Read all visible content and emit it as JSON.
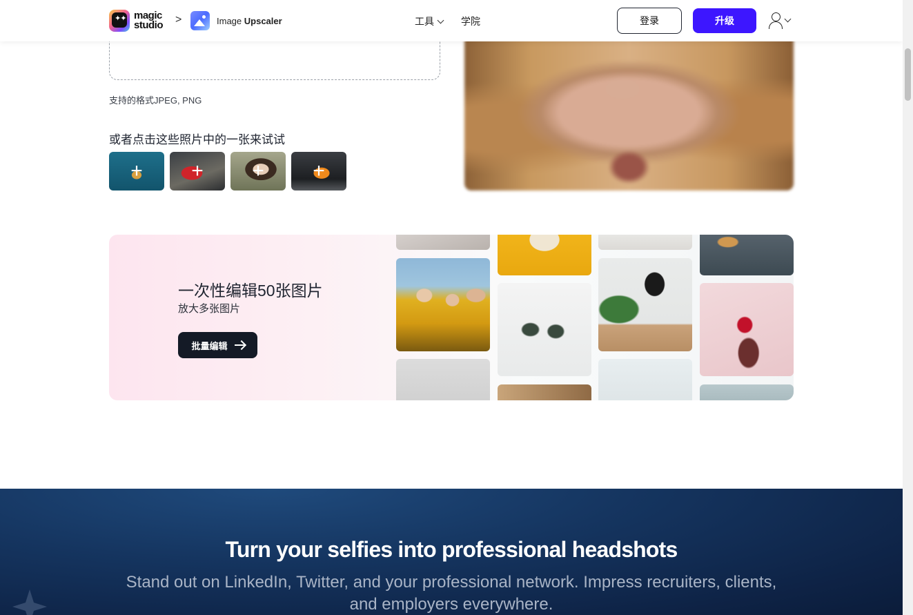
{
  "header": {
    "logo_text_line1": "magic",
    "logo_text_line2": "studio",
    "breadcrumb_separator": ">",
    "app_name_prefix": "Image",
    "app_name_main": "Upscaler",
    "nav": [
      {
        "label": "工具",
        "has_dropdown": true
      },
      {
        "label": "学院",
        "has_dropdown": false
      }
    ],
    "login_label": "登录",
    "upgrade_label": "升级",
    "accent_color": "#3d16ff"
  },
  "upload": {
    "formats_text": "支持的格式JPEG, PNG",
    "try_title": "或者点击这些照片中的一张来试试",
    "samples": [
      {
        "icon": "plus-icon",
        "subject": "dog"
      },
      {
        "icon": "plus-icon",
        "subject": "soda-can"
      },
      {
        "icon": "plus-icon",
        "subject": "woman-portrait"
      },
      {
        "icon": "plus-icon",
        "subject": "sports-car"
      }
    ],
    "sample_plus": "+"
  },
  "batch": {
    "title": "一次性编辑50张图片",
    "subtitle": "放大多张图片",
    "button_label": "批量编辑"
  },
  "headshots": {
    "title": "Turn your selfies into professional headshots",
    "subtitle": "Stand out on LinkedIn, Twitter, and your professional network. Impress recruiters, clients, and employers everywhere."
  }
}
